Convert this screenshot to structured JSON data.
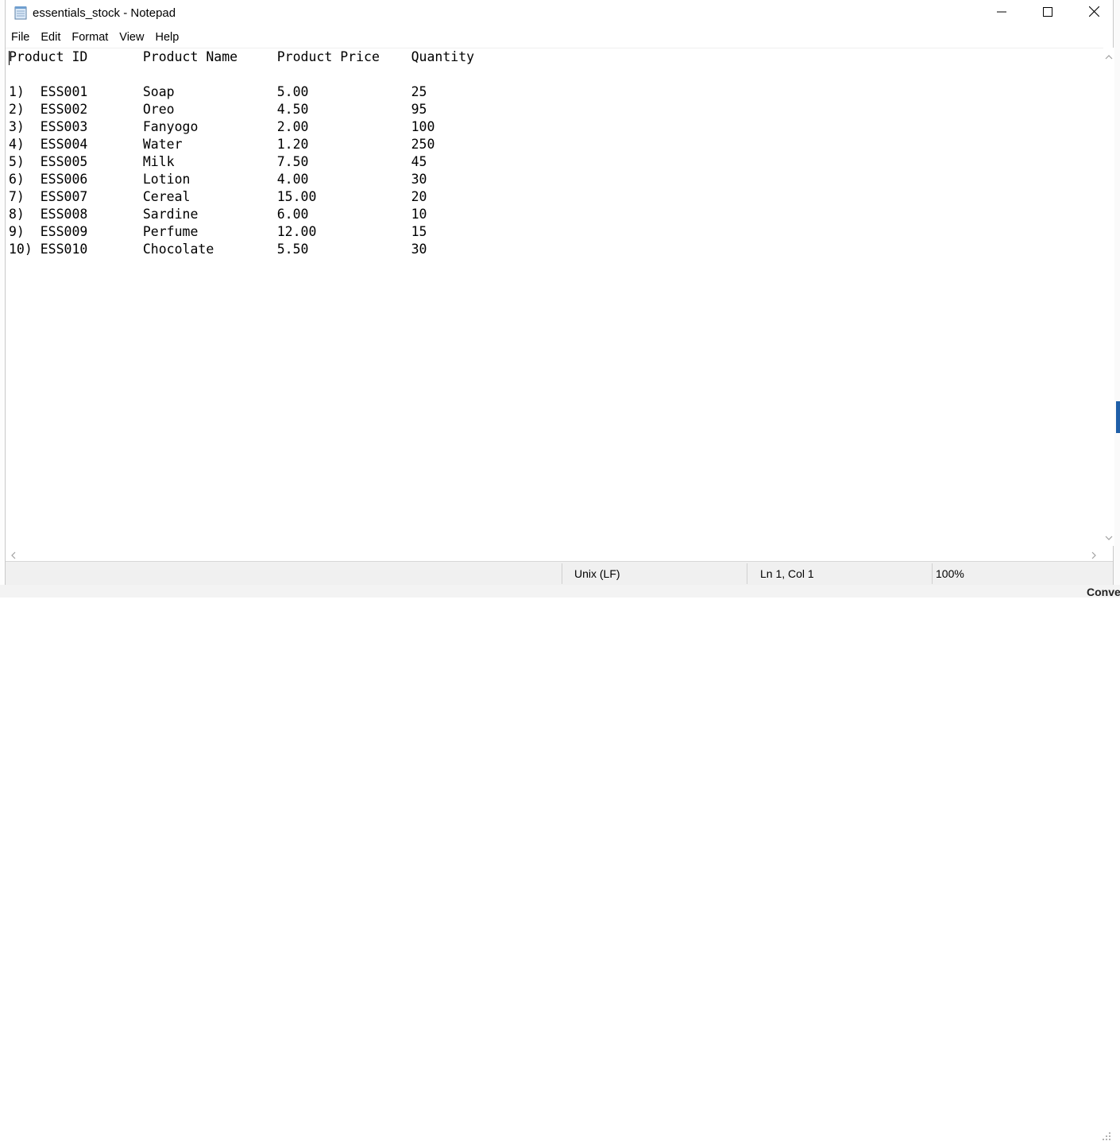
{
  "window": {
    "title": "essentials_stock - Notepad"
  },
  "menu": {
    "items": [
      "File",
      "Edit",
      "Format",
      "View",
      "Help"
    ]
  },
  "document": {
    "lines": [
      "Product ID       Product Name     Product Price    Quantity",
      "",
      "1)  ESS001       Soap             5.00             25",
      "2)  ESS002       Oreo             4.50             95",
      "3)  ESS003       Fanyogo          2.00             100",
      "4)  ESS004       Water            1.20             250",
      "5)  ESS005       Milk             7.50             45",
      "6)  ESS006       Lotion           4.00             30",
      "7)  ESS007       Cereal           15.00            20",
      "8)  ESS008       Sardine          6.00             10",
      "9)  ESS009       Perfume          12.00            15",
      "10) ESS010       Chocolate        5.50             30"
    ]
  },
  "status": {
    "line_ending": "Unix (LF)",
    "position": "Ln 1, Col 1",
    "zoom": "100%"
  },
  "background": {
    "partial_text": "Conve"
  },
  "icons": {
    "app": "notepad-icon",
    "minimize": "minimize-icon",
    "maximize": "maximize-icon",
    "close": "close-icon"
  },
  "colors": {
    "accent_strip": "#1f5fa8",
    "statusbar": "#f0f0f0"
  }
}
